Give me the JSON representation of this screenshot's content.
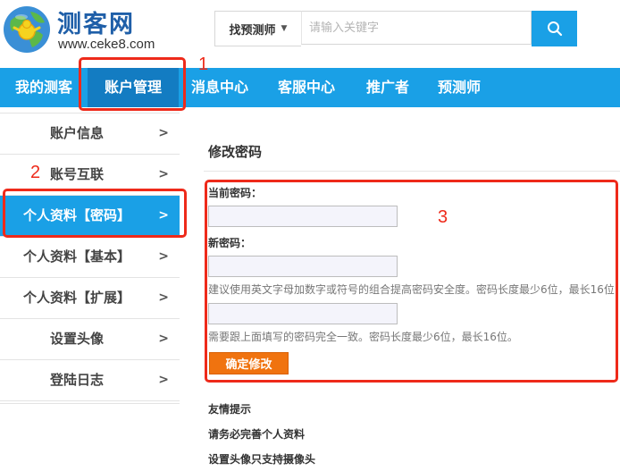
{
  "header": {
    "logo_name": "测客网",
    "logo_url": "www.ceke8.com",
    "search_type": "找预测师",
    "search_placeholder": "请输入关键字",
    "search_icon": "magnifier"
  },
  "nav": {
    "items": [
      {
        "label": "我的测客"
      },
      {
        "label": "账户管理",
        "active": true
      },
      {
        "label": "消息中心"
      },
      {
        "label": "客服中心"
      },
      {
        "label": "推广者"
      },
      {
        "label": "预测师"
      }
    ]
  },
  "sidebar": {
    "arrow": ">",
    "items": [
      {
        "label": "账户信息"
      },
      {
        "label": "账号互联"
      },
      {
        "label": "个人资料【密码】",
        "active": true
      },
      {
        "label": "个人资料【基本】"
      },
      {
        "label": "个人资料【扩展】"
      },
      {
        "label": "设置头像"
      },
      {
        "label": "登陆日志"
      }
    ]
  },
  "main": {
    "title": "修改密码",
    "current_label": "当前密码：",
    "new_label": "新密码：",
    "new_hint": "建议使用英文字母加数字或符号的组合提高密码安全度。密码长度最少6位，最长16位",
    "confirm_hint": "需要跟上面填写的密码完全一致。密码长度最少6位，最长16位。",
    "submit": "确定修改"
  },
  "tips": {
    "title": "友情提示",
    "items": [
      "请务必完善个人资料",
      "设置头像只支持摄像头"
    ]
  },
  "annotations": {
    "n1": "1",
    "n2": "2",
    "n3": "3"
  },
  "colors": {
    "brand_blue": "#1aa0e6",
    "nav_active": "#137cc2",
    "submit_orange": "#f0730f",
    "annotation_red": "#ee2a1a"
  }
}
